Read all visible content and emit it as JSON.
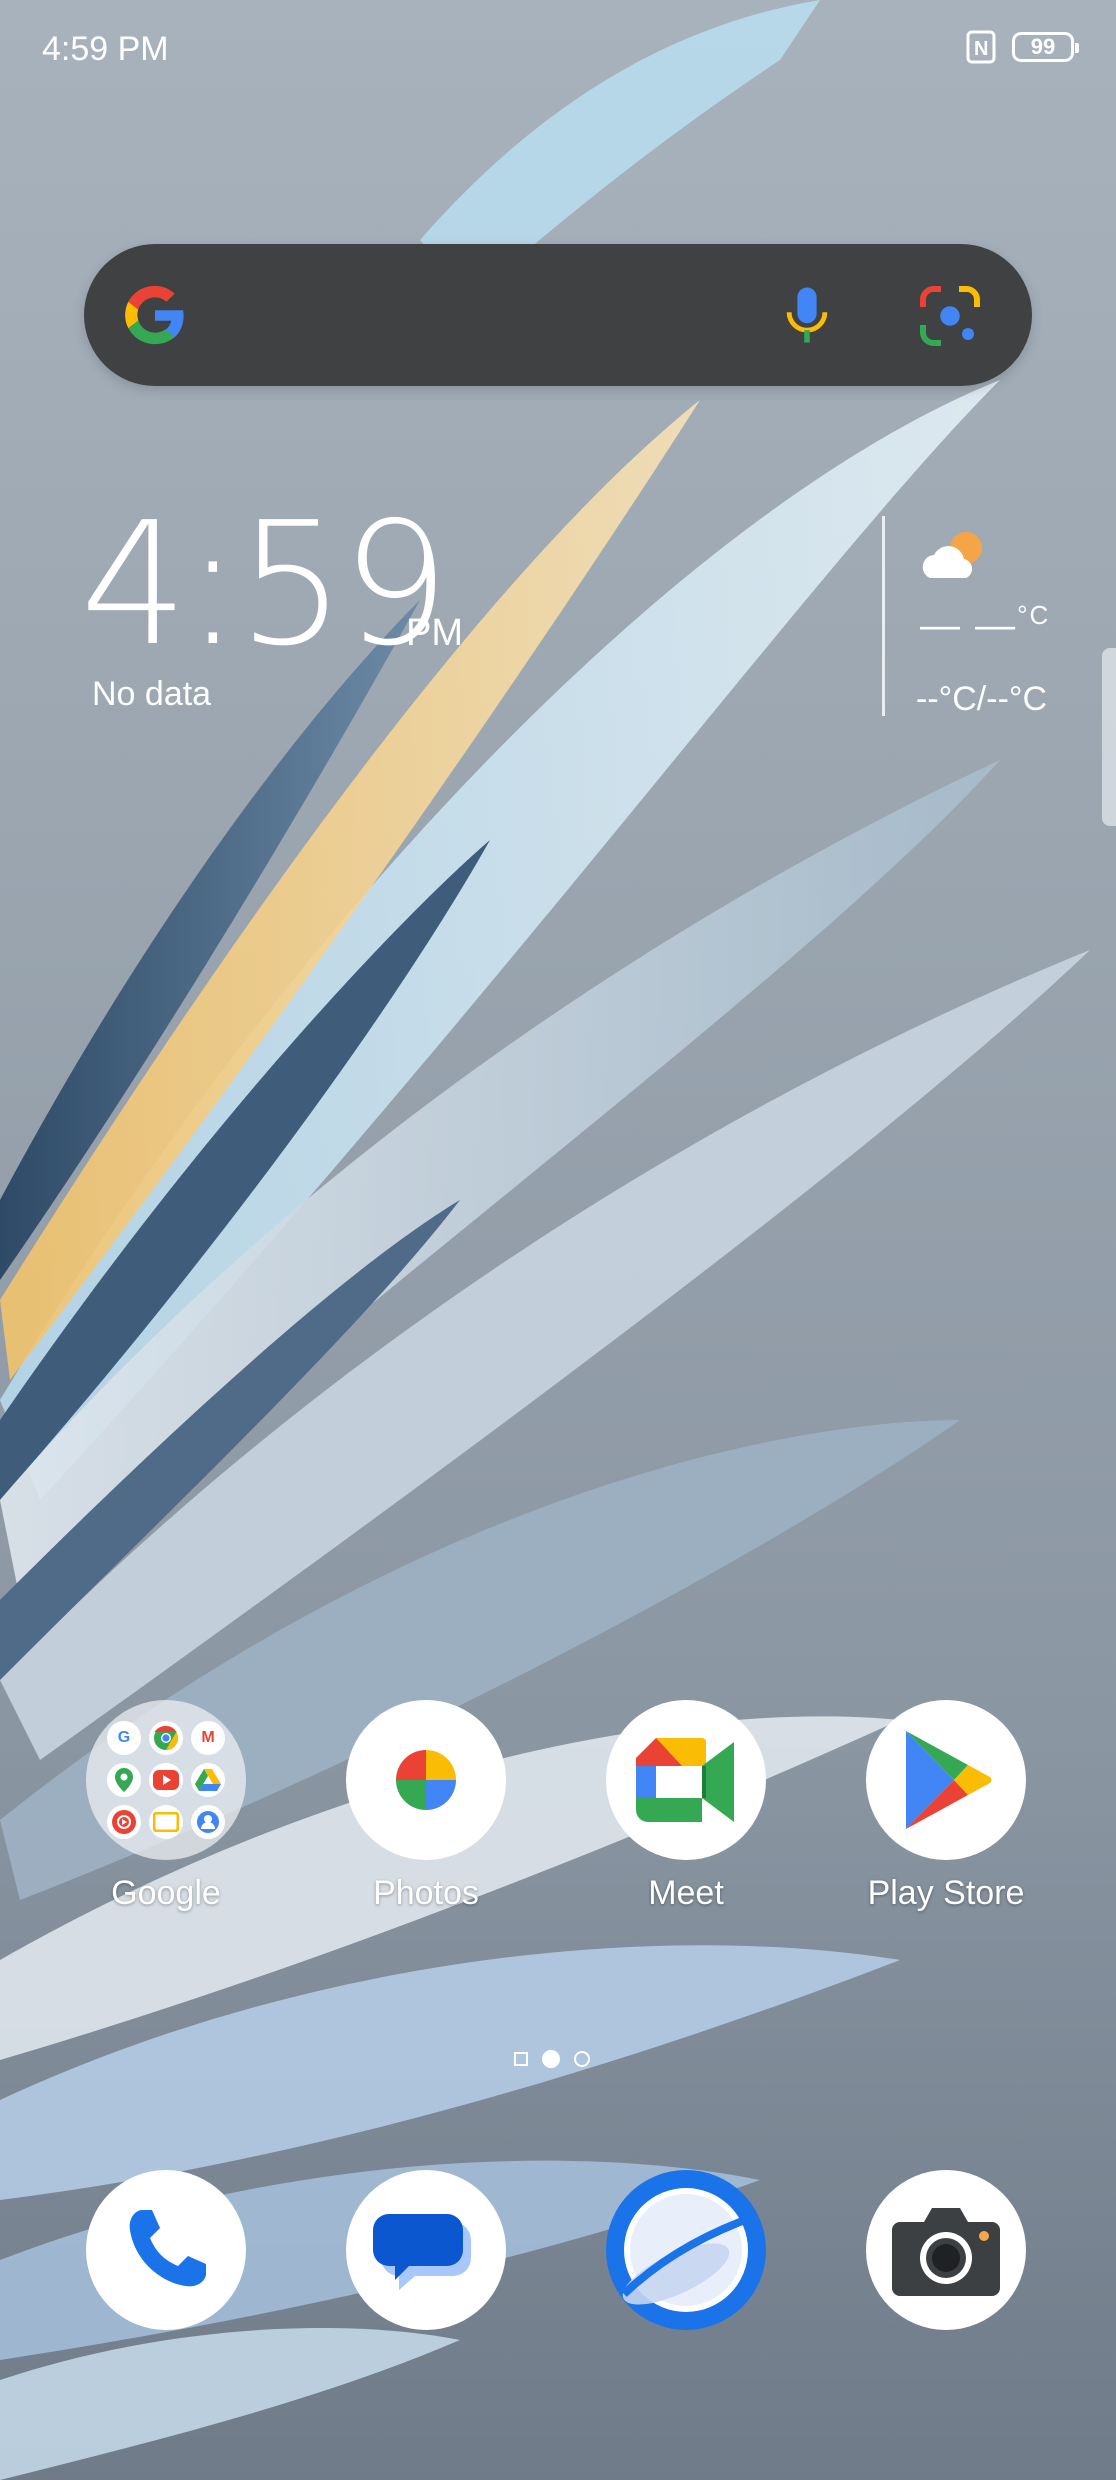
{
  "status_bar": {
    "time": "4:59 PM",
    "battery": "99"
  },
  "search_bar": {
    "logo": "google-g-icon",
    "mic": "mic-icon",
    "lens": "lens-icon"
  },
  "clock_widget": {
    "time": "4:59",
    "ampm": "PM",
    "subtitle": "No data"
  },
  "weather_widget": {
    "temp": "— —",
    "unit": "°C",
    "range": "--°C/--°C",
    "icon": "partly-cloudy-icon"
  },
  "home_apps": [
    {
      "label": "Google",
      "icon": "google-folder-icon"
    },
    {
      "label": "Photos",
      "icon": "photos-icon"
    },
    {
      "label": "Meet",
      "icon": "meet-icon"
    },
    {
      "label": "Play Store",
      "icon": "play-store-icon"
    }
  ],
  "dock": [
    {
      "icon": "phone-icon"
    },
    {
      "icon": "messages-icon"
    },
    {
      "icon": "browser-icon"
    },
    {
      "icon": "camera-icon"
    }
  ],
  "colors": {
    "google_blue": "#4285F4",
    "google_red": "#EA4335",
    "google_yellow": "#FBBC05",
    "google_green": "#34A853",
    "search_bg": "#3f4142"
  }
}
